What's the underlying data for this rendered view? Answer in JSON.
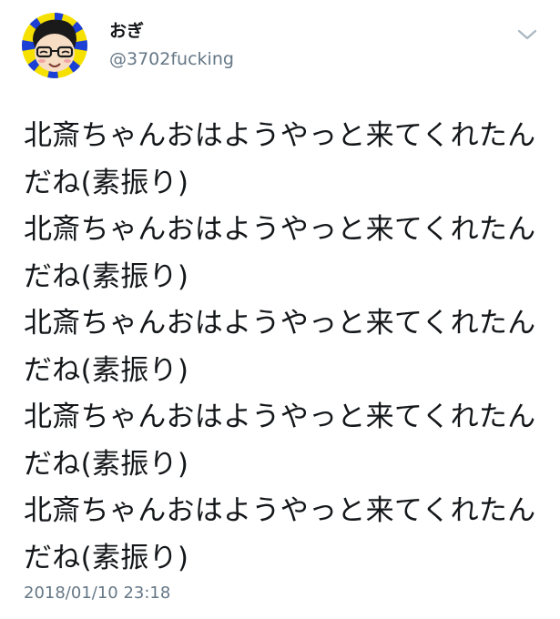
{
  "tweet": {
    "display_name": "おぎ",
    "handle": "@3702fucking",
    "text": "北斎ちゃんおはようやっと来てくれたんだね(素振り)\n北斎ちゃんおはようやっと来てくれたんだね(素振り)\n北斎ちゃんおはようやっと来てくれたんだね(素振り)\n北斎ちゃんおはようやっと来てくれたんだね(素振り)\n北斎ちゃんおはようやっと来てくれたんだね(素振り)",
    "timestamp": "2018/01/10 23:18",
    "menu_icon": "chevron-down-icon",
    "avatar_icon": "avatar-illustration"
  },
  "colors": {
    "text": "#14171a",
    "secondary": "#657786",
    "caret": "#aab8c2",
    "avatar_yellow": "#f5e000",
    "avatar_blue": "#1c3fd6"
  }
}
